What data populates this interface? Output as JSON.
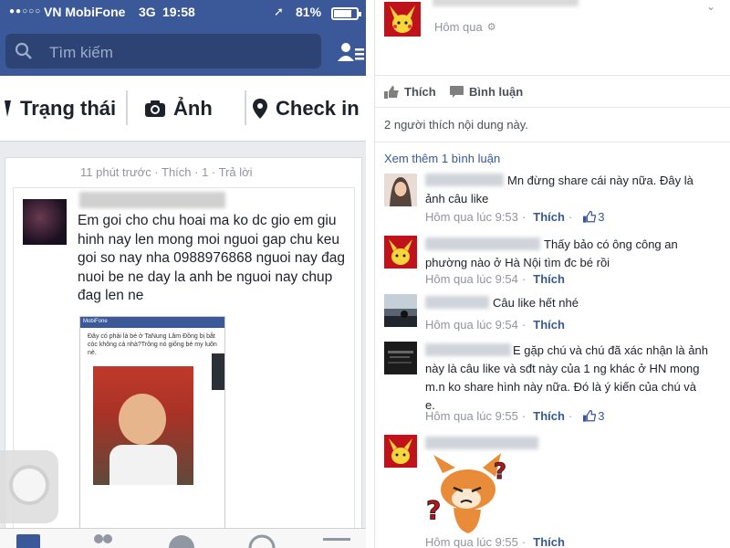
{
  "phone": {
    "status_bar": {
      "carrier": "VN MobiFone",
      "network": "3G",
      "time": "19:58",
      "battery": "81%",
      "battery_level": 0.81
    },
    "search": {
      "placeholder": "Tìm kiếm"
    },
    "composer": {
      "status": "Trạng thái",
      "photo": "Ảnh",
      "checkin": "Check in"
    },
    "inner_meta": "11 phút trước · Thích · 1 · Trả lời",
    "inner_post_text": "Em goi cho chu hoai ma ko dc gio em giu hinh nay len mong moi nguoi gap chu keu goi so nay nha 0988976868 nguoi nay đag nuoi be ne day la anh be nguoi nay chup đag len ne",
    "inner_screenshot": {
      "carrier": "MobiFone",
      "caption": "Đây có phải là bé ở TaNung Lâm Đồng bị bắt cóc không cả nhà?Trông nó giống bé my luôn nè."
    }
  },
  "post": {
    "time": "Hôm qua",
    "actions": {
      "like": "Thích",
      "comment": "Bình luận"
    },
    "likes_summary": "2 người thích nội dung này.",
    "more_comments": "Xem thêm 1 bình luận"
  },
  "comments": [
    {
      "text": "Mn đừng share cái này nữa. Đây là ảnh câu like",
      "time": "Hôm qua lúc 9:53",
      "like": "Thích",
      "likes": "3"
    },
    {
      "text": "Thấy bảo có ông công an phường nào ở Hà Nội tìm đc bé rồi",
      "time": "Hôm qua lúc 9:54",
      "like": "Thích",
      "likes": ""
    },
    {
      "text": "Câu like hết nhé",
      "time": "Hôm qua lúc 9:54",
      "like": "Thích",
      "likes": ""
    },
    {
      "text": "E gặp chú và chú đã xác nhận là ảnh này là câu like và sđt này của 1 ng khác ở HN mong m.n ko share hình này nữa. Đó là ý kiến của chú và e.",
      "time": "Hôm qua lúc 9:55",
      "like": "Thích",
      "likes": "3"
    },
    {
      "text": "",
      "time": "Hôm qua lúc 9:55",
      "like": "Thích",
      "likes": ""
    }
  ],
  "colors": {
    "facebook_blue": "#3b5998",
    "link_blue": "#365899",
    "meta_gray": "#90949c"
  }
}
